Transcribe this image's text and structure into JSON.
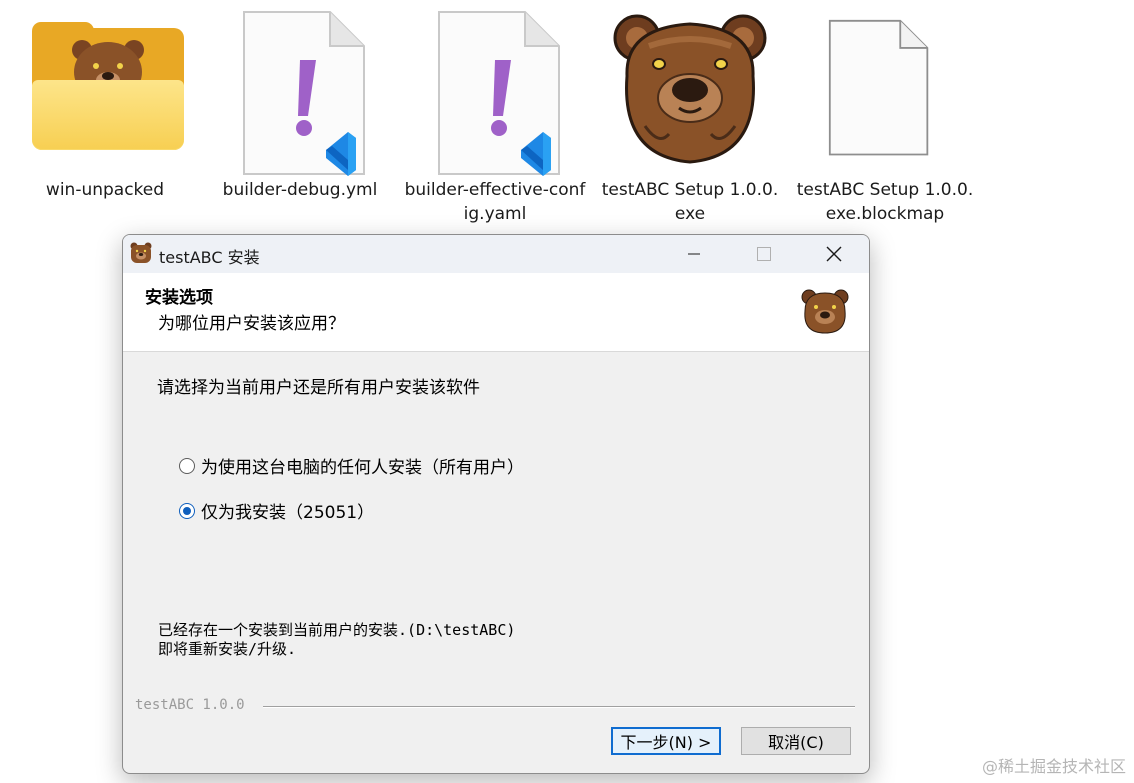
{
  "files": [
    {
      "name": "win-unpacked",
      "icon": "folder-icon"
    },
    {
      "name": "builder-debug.yml",
      "icon": "vscode-yaml-file-icon"
    },
    {
      "name": "builder-effective-config.yaml",
      "icon": "vscode-yaml-file-icon"
    },
    {
      "name": "testABC Setup 1.0.0.exe",
      "icon": "bear-app-icon"
    },
    {
      "name": "testABC Setup 1.0.0.exe.blockmap",
      "icon": "blank-file-icon"
    }
  ],
  "dialog": {
    "title": "testABC 安装",
    "header_title": "安装选项",
    "header_subtitle": "为哪位用户安装该应用？",
    "prompt": "请选择为当前用户还是所有用户安装该软件",
    "options": [
      {
        "label": "为使用这台电脑的任何人安装（所有用户）",
        "checked": false
      },
      {
        "label": "仅为我安装（25051）",
        "checked": true
      }
    ],
    "notice_line1": "已经存在一个安装到当前用户的安装.(D:\\testABC)",
    "notice_line2": "即将重新安装/升级.",
    "branding": "testABC 1.0.0",
    "next_label": "下一步(N) >",
    "cancel_label": "取消(C)"
  },
  "watermark": "@稀土掘金技术社区",
  "colors": {
    "accent": "#0f5fbd",
    "folder": "#e8a825",
    "yaml_exclaim": "#9f61c8",
    "vscode_blue": "#1e88e5",
    "bear_brown": "#8a5228"
  }
}
